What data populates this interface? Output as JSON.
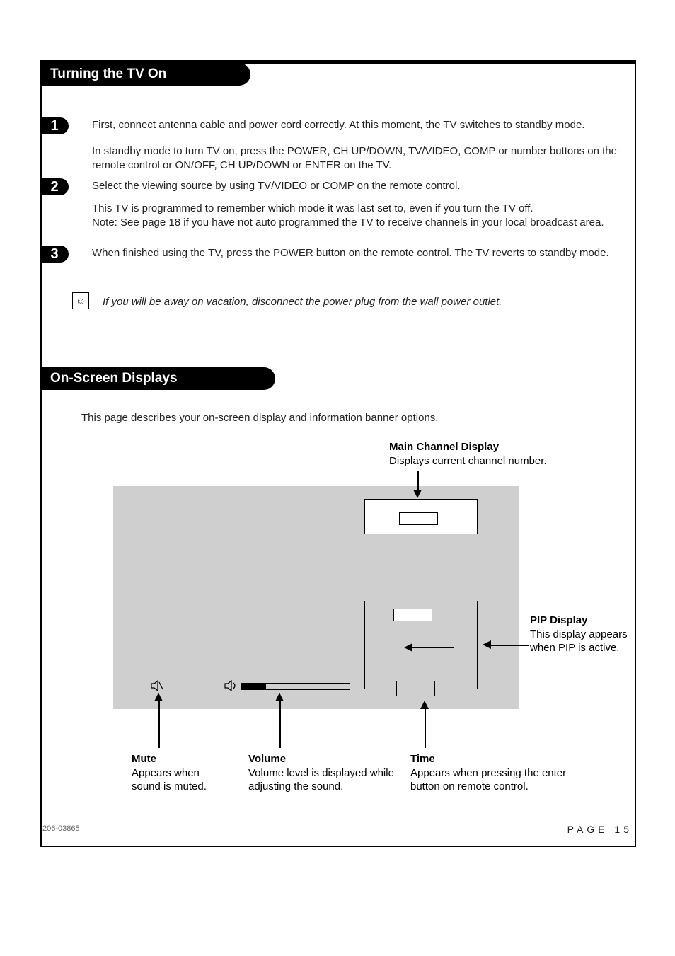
{
  "sections": {
    "turning_on": "Turning the TV On",
    "osd": "On-Screen Displays"
  },
  "steps": {
    "s1_badge": "1",
    "s1_p1": "First, connect antenna cable and power cord correctly. At this moment, the TV switches to standby mode.",
    "s1_p2": "In standby mode to turn TV on, press the POWER, CH UP/DOWN, TV/VIDEO, COMP or number buttons on the remote control or ON/OFF, CH UP/DOWN or ENTER on the TV.",
    "s2_badge": "2",
    "s2_p1": "Select the viewing source by using TV/VIDEO or COMP on the remote control.",
    "s2_p2": "This TV is programmed to remember which mode it was last set to, even if you turn the TV off.\nNote: See page 18  if you have not auto programmed the TV to receive channels in your local broadcast area.",
    "s3_badge": "3",
    "s3_p1": "When finished using the TV,  press the POWER button on the remote control. The TV reverts to standby mode.",
    "tip": "If you will be away on vacation, disconnect the power plug from the wall power outlet."
  },
  "osd_intro": "This page describes your on-screen display and information banner options.",
  "callouts": {
    "main_ch_title": "Main Channel Display",
    "main_ch_desc": "Displays current channel number.",
    "pip_title": "PIP Display",
    "pip_desc": "This display appears when PIP is active.",
    "mute_title": "Mute",
    "mute_desc": "Appears when sound is muted.",
    "vol_title": "Volume",
    "vol_desc": "Volume level is displayed while adjusting the sound.",
    "time_title": "Time",
    "time_desc": "Appears when pressing the enter button on remote control."
  },
  "footer": {
    "doc_no": "206-03865",
    "page_label": "PAGE 15"
  }
}
